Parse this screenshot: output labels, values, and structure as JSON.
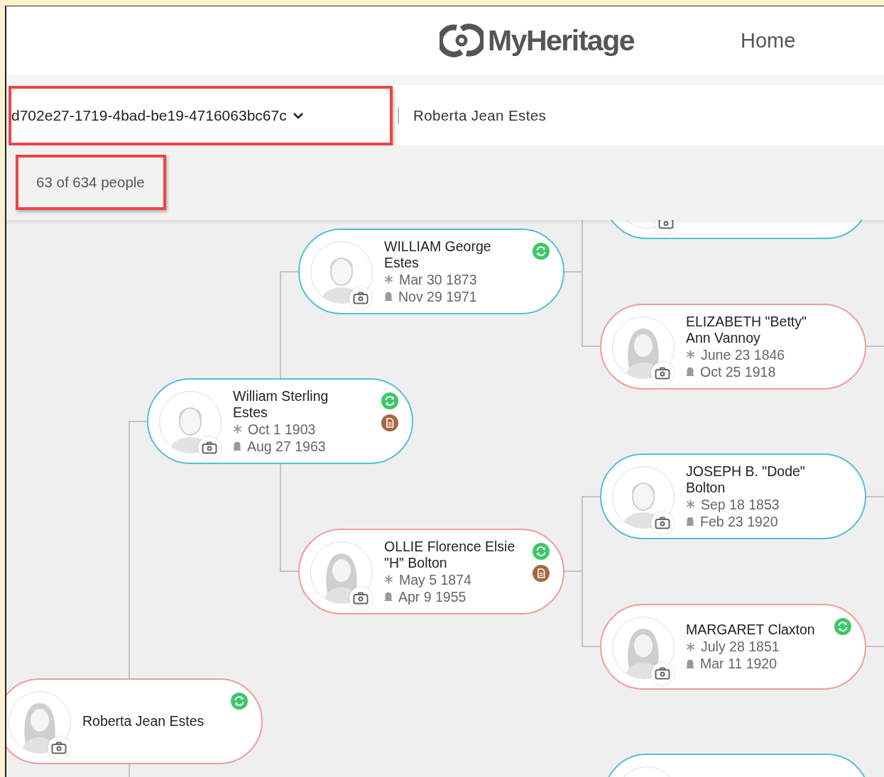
{
  "header": {
    "logo": "MyHeritage",
    "nav": [
      {
        "label": "Home"
      }
    ]
  },
  "toolbar": {
    "tree_selector": "d702e27-1719-4bad-be19-4716063bc67c",
    "root_person": "Roberta Jean Estes"
  },
  "counter": "63 of 634 people",
  "people": [
    {
      "kind": "male"
    },
    {
      "kind": "male",
      "name": "WILLIAM George\nEstes",
      "birth": "Mar 30 1873",
      "death": "Nov 29 1971",
      "synced": true
    },
    {
      "kind": "female",
      "name": "ELIZABETH \"Betty\"\nAnn Vannoy",
      "birth": "June 23 1846",
      "death": "Oct 25 1918"
    },
    {
      "kind": "male",
      "name": "William Sterling\nEstes",
      "birth": "Oct 1 1903",
      "death": "Aug 27 1963",
      "synced": true,
      "records": true
    },
    {
      "kind": "male",
      "name": "JOSEPH B. \"Dode\"\nBolton",
      "birth": "Sep 18 1853",
      "death": "Feb 23 1920"
    },
    {
      "kind": "female",
      "name": "OLLIE Florence Elsie\n\"H\" Bolton",
      "birth": "May 5 1874",
      "death": "Apr 9 1955",
      "synced": true,
      "records": true
    },
    {
      "kind": "female",
      "name": "MARGARET Claxton",
      "birth": "July 28 1851",
      "death": "Mar 11 1920",
      "synced": true
    },
    {
      "kind": "female",
      "name": "Roberta Jean Estes",
      "synced": true
    },
    {
      "kind": "male"
    }
  ]
}
